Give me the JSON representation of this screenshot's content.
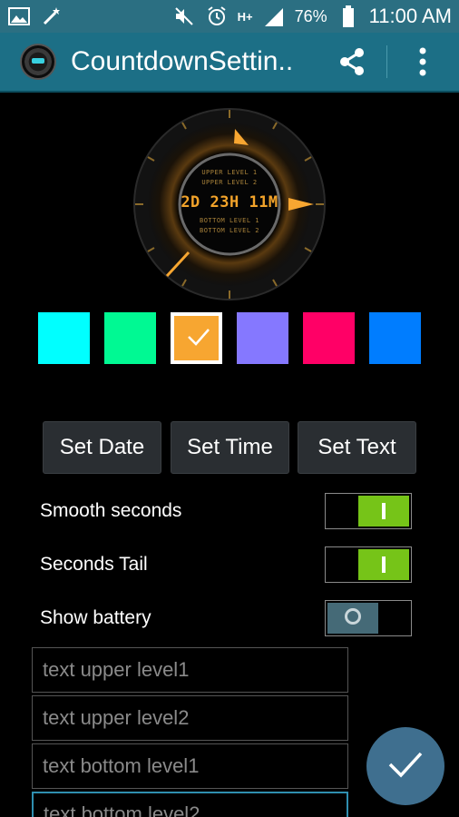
{
  "status_bar": {
    "battery_percent": "76%",
    "time": "11:00 AM",
    "network": "H+",
    "left_icons": [
      "image-icon",
      "magic-wand-icon"
    ],
    "right_icons": [
      "mute-icon",
      "alarm-icon",
      "signal-icon",
      "battery-icon"
    ]
  },
  "app_bar": {
    "title": "CountdownSettin..",
    "icons": [
      "share-icon",
      "overflow-menu-icon"
    ]
  },
  "watch_preview": {
    "upper_level_1": "UPPER LEVEL 1",
    "upper_level_2": "UPPER LEVEL 2",
    "countdown": "2D 23H 11M",
    "bottom_level_1": "BOTTOM LEVEL 1",
    "bottom_level_2": "BOTTOM LEVEL 2",
    "accent_color": "#f7a631"
  },
  "colors": {
    "swatches": [
      "#00ffff",
      "#00f993",
      "#f7a631",
      "#8578ff",
      "#ff0066",
      "#007dff"
    ],
    "selected_index": 2
  },
  "buttons": {
    "set_date": "Set Date",
    "set_time": "Set Time",
    "set_text": "Set Text"
  },
  "settings": {
    "smooth_seconds": {
      "label": "Smooth seconds",
      "on": true
    },
    "seconds_tail": {
      "label": "Seconds Tail",
      "on": true
    },
    "show_battery": {
      "label": "Show battery",
      "on": false
    }
  },
  "fields": {
    "upper_level1": {
      "placeholder": "text upper level1",
      "value": ""
    },
    "upper_level2": {
      "placeholder": "text upper level2",
      "value": ""
    },
    "bottom_level1": {
      "placeholder": "text bottom level1",
      "value": ""
    },
    "bottom_level2": {
      "placeholder": "text bottom level2",
      "value": ""
    }
  },
  "fab": {
    "icon": "checkmark-icon",
    "color": "#3f6f8f"
  }
}
